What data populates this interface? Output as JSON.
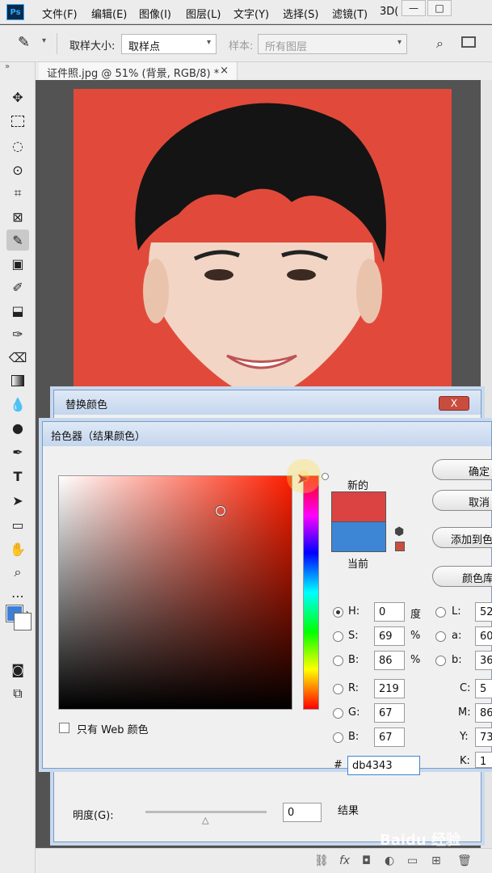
{
  "menu": {
    "logo": "Ps",
    "items": [
      "文件(F)",
      "编辑(E)",
      "图像(I)",
      "图层(L)",
      "文字(Y)",
      "选择(S)",
      "滤镜(T)",
      "3D("
    ],
    "window_buttons": [
      "—",
      "□"
    ]
  },
  "options": {
    "sample_size_label": "取样大小:",
    "sample_size_value": "取样点",
    "sample_label": "样本:",
    "sample_value": "所有图层"
  },
  "document": {
    "tab_title": "证件照.jpg @ 51% (背景, RGB/8) *",
    "close": "×"
  },
  "replace_dialog": {
    "title": "替换颜色",
    "close": "X",
    "lightness_label": "明度(G):",
    "lightness_value": "0",
    "result_label": "结果"
  },
  "picker": {
    "title": "拾色器（结果颜色）",
    "new_label": "新的",
    "current_label": "当前",
    "new_color": "#db4343",
    "current_color": "#3d86d6",
    "buttons": [
      "确定",
      "取消",
      "添加到色",
      "颜色库"
    ],
    "web_only_label": "只有 Web 颜色",
    "hsb": [
      {
        "label": "H:",
        "value": "0",
        "unit": "度"
      },
      {
        "label": "S:",
        "value": "69",
        "unit": "%"
      },
      {
        "label": "B:",
        "value": "86",
        "unit": "%"
      }
    ],
    "rgb": [
      {
        "label": "R:",
        "value": "219"
      },
      {
        "label": "G:",
        "value": "67"
      },
      {
        "label": "B:",
        "value": "67"
      }
    ],
    "lab": [
      {
        "label": "L:",
        "value": "52"
      },
      {
        "label": "a:",
        "value": "60"
      },
      {
        "label": "b:",
        "value": "36"
      }
    ],
    "cmyk": [
      {
        "label": "C:",
        "value": "5"
      },
      {
        "label": "M:",
        "value": "86"
      },
      {
        "label": "Y:",
        "value": "73"
      },
      {
        "label": "K:",
        "value": "1"
      }
    ],
    "hex_label": "#",
    "hex_value": "db4343"
  },
  "watermark": "Baidu 经验"
}
